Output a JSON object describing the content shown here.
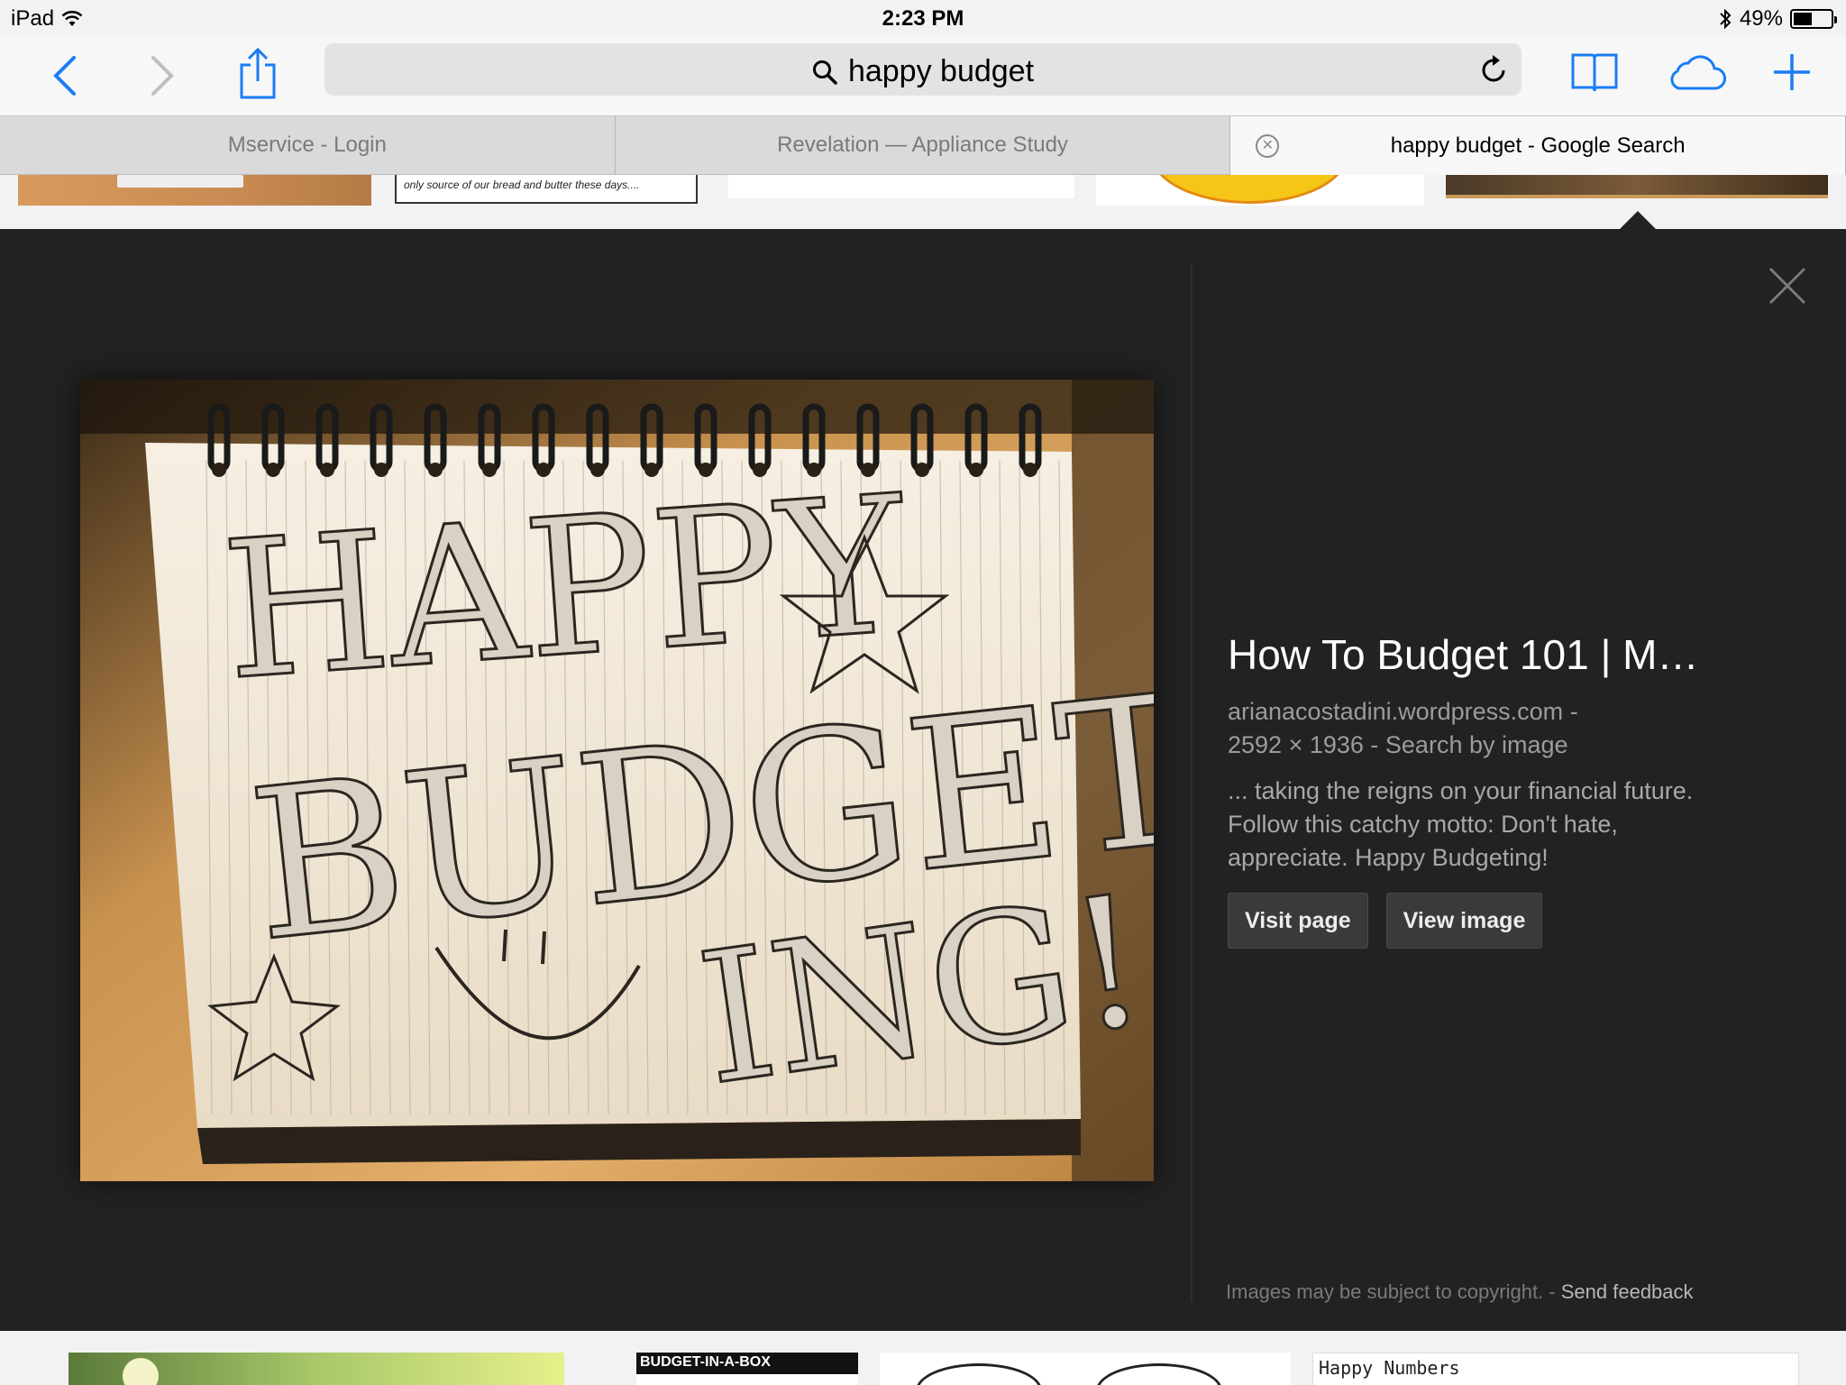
{
  "status_bar": {
    "device": "iPad",
    "time": "2:23 PM",
    "battery": "49%",
    "battery_level": 0.49
  },
  "toolbar": {
    "search_query": "happy budget"
  },
  "tabs": [
    {
      "label": "Mservice - Login",
      "active": false
    },
    {
      "label": "Revelation — Appliance Study",
      "active": false
    },
    {
      "label": "happy budget - Google Search",
      "active": true
    }
  ],
  "thumbnails": {
    "top_strip_text": "only source of our bread and butter these days....",
    "bottom_strip_texts": [
      "BUDGET-IN-A-BOX",
      "Happy Numbers"
    ]
  },
  "image_panel": {
    "title": "How To Budget 101 | M…",
    "source_site": "arianacostadini.wordpress.com",
    "dimensions": "2592 × 1936",
    "search_by_image": "Search by image",
    "description": "... taking the reigns on your financial future. Follow this catchy motto: Don't hate, appreciate. Happy Budgeting!",
    "visit_page_label": "Visit page",
    "view_image_label": "View image",
    "copyright_note": "Images may be subject to copyright.",
    "feedback_label": "Send feedback",
    "image_text": {
      "line1": "HAPPY",
      "line2": "BUDGET-",
      "line3": "ING!"
    }
  }
}
